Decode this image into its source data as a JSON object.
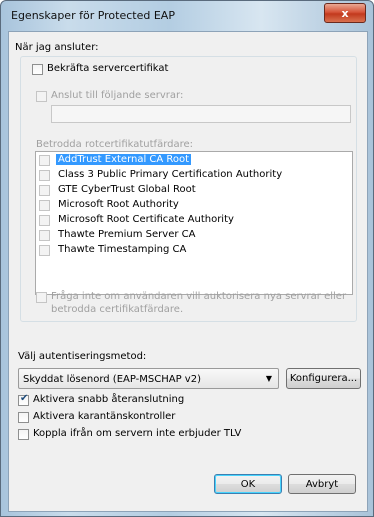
{
  "window": {
    "title": "Egenskaper för Protected EAP",
    "close_glyph": "x"
  },
  "connect_heading": "När jag ansluter:",
  "verify_cert": {
    "label": "Bekräfta servercertifikat",
    "checked": false
  },
  "connect_servers": {
    "label": "Anslut till följande servrar:",
    "checked": false,
    "value": ""
  },
  "trusted_ca": {
    "label": "Betrodda rotcertifikatutfärdare:",
    "items": [
      {
        "label": "AddTrust External CA Root",
        "checked": false,
        "selected": true
      },
      {
        "label": "Class 3 Public Primary Certification Authority",
        "checked": false,
        "selected": false
      },
      {
        "label": "GTE CyberTrust Global Root",
        "checked": false,
        "selected": false
      },
      {
        "label": "Microsoft Root Authority",
        "checked": false,
        "selected": false
      },
      {
        "label": "Microsoft Root Certificate Authority",
        "checked": false,
        "selected": false
      },
      {
        "label": "Thawte Premium Server CA",
        "checked": false,
        "selected": false
      },
      {
        "label": "Thawte Timestamping CA",
        "checked": false,
        "selected": false
      }
    ]
  },
  "dont_prompt": {
    "line1": "Fråga inte om användaren vill auktorisera nya servrar eller",
    "line2": "betrodda certifikatfärdare.",
    "checked": false
  },
  "auth_method": {
    "label": "Välj autentiseringsmetod:",
    "selected": "Skyddat lösenord (EAP-MSCHAP v2)",
    "configure_label": "Konfigurera..."
  },
  "options": [
    {
      "label": "Aktivera snabb återanslutning",
      "checked": true
    },
    {
      "label": "Aktivera karantänskontroller",
      "checked": false
    },
    {
      "label": "Koppla ifrån om servern inte erbjuder TLV",
      "checked": false
    }
  ],
  "buttons": {
    "ok": "OK",
    "cancel": "Avbryt"
  },
  "colors": {
    "selection": "#3399ff",
    "close": "#c2391d"
  }
}
